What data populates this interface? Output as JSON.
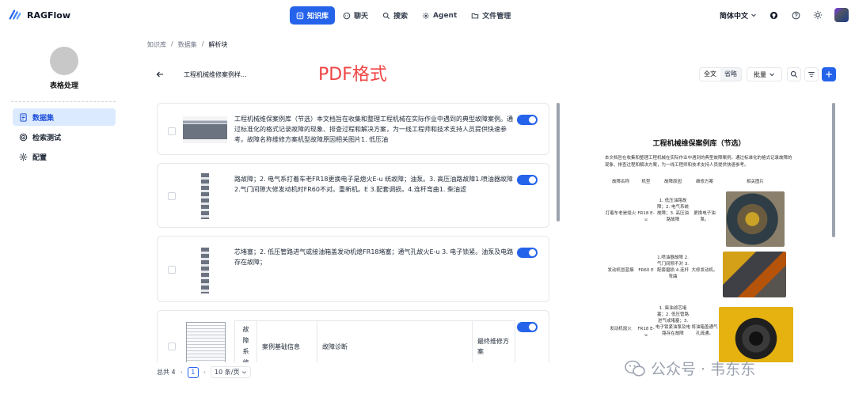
{
  "app": {
    "name": "RAGFlow"
  },
  "nav": [
    {
      "label": "知识库",
      "icon": "database-icon",
      "active": true
    },
    {
      "label": "聊天",
      "icon": "chat-icon",
      "active": false
    },
    {
      "label": "搜索",
      "icon": "search-icon",
      "active": false
    },
    {
      "label": "Agent",
      "icon": "agent-icon",
      "active": false
    },
    {
      "label": "文件管理",
      "icon": "folder-icon",
      "active": false
    }
  ],
  "header": {
    "language": "简体中文"
  },
  "sidebar": {
    "kb_name": "表格处理",
    "items": [
      {
        "label": "数据集",
        "icon": "document-icon",
        "active": true
      },
      {
        "label": "检索测试",
        "icon": "target-icon",
        "active": false
      },
      {
        "label": "配置",
        "icon": "gear-icon",
        "active": false
      }
    ]
  },
  "breadcrumb": [
    "知识库",
    "/",
    "数据集",
    "/",
    "解析块"
  ],
  "doc": {
    "title": "工程机械维修案例样..."
  },
  "annotation": "PDF格式",
  "toolbar": {
    "view_full": "全文",
    "view_omit": "省略",
    "batch": "批量"
  },
  "chunks": [
    {
      "text": "工程机械维保案例库（节选）本文档旨在收集和整理工程机械在实际作业中遇到的典型故障案例。通过标准化的格式记录故障的现象、排查过程和解决方案，为一线工程师和技术支持人员提供快速参考。故障名称维修方案机型故障原因相关图片1. 低压油",
      "enabled": true
    },
    {
      "text": "路故障；2. 电气系打着车老FR18更换电子是熄火E-u 统故障；油泵。3. 高压油路故障1.喷油器故障2.气门间隙大修发动机时FR60不对。重新机。E 3.配套调损。4.连杆弯曲1. 柴油滤",
      "enabled": true
    },
    {
      "text": "芯堵塞；2. 低压管路进气或接油箱盖发动机熄FR18堵塞；通气孔故火E-u 3. 电子锁紧。油泵及电路存在故障；",
      "enabled": true
    },
    {
      "table": [
        "故障系统",
        "案例基础信息",
        "故障诊断",
        "最终维修方案"
      ],
      "enabled": true
    }
  ],
  "pagination": {
    "total": "总共 4",
    "page": "1",
    "page_size": "10 条/页"
  },
  "pdf": {
    "title": "工程机械维保案例库（节选）",
    "intro": "本文档旨在收集和整理工程机械在实际作业中遇到的典型故障案例。通过标准化的格式记录故障的现象、排查过程和解决方案，为一线工程师和技术支持人员提供快速参考。",
    "headers": [
      "故障名称",
      "机型",
      "故障原因",
      "维修方案",
      "相关图片"
    ],
    "rows": [
      {
        "name": "打着车老是熄火",
        "model": "FR18 E-u",
        "cause": "1. 低压油路故障；2. 电气系统故障；3. 高压油路故障",
        "fix": "更换电子油泵。"
      },
      {
        "name": "发动机冒蓝烟",
        "model": "FR60 E",
        "cause": "1.喷油器故障 2.气门间隙不对 3.配套磨损 4.连杆弯曲",
        "fix": "大修发动机。"
      },
      {
        "name": "发动机熄火",
        "model": "FR18 E-u",
        "cause": "1. 柴油滤芯堵塞；2. 低压管路进气或堵塞；3. 电子锁紧油泵及电路存在故障",
        "fix": "将油箱盖通气孔疏通。"
      }
    ]
  },
  "watermark": "公众号 · 韦东东",
  "colors": {
    "accent": "#2563eb",
    "annotation": "#ef4444"
  }
}
